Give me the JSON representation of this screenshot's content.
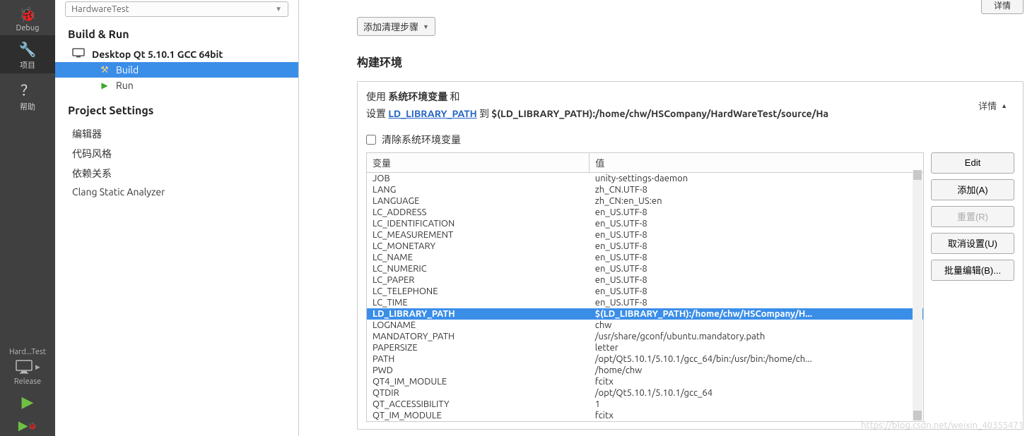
{
  "iconbar": {
    "debug": "Debug",
    "projects": "项目",
    "help": "帮助",
    "kit_name": "Hard...Test",
    "build_cfg": "Release"
  },
  "sidebar": {
    "project_combo": "HardwareTest",
    "build_run": "Build & Run",
    "kit": "Desktop Qt 5.10.1 GCC 64bit",
    "tree": {
      "build": "Build",
      "run": "Run"
    },
    "project_settings": "Project Settings",
    "settings": [
      "编辑器",
      "代码风格",
      "依赖关系",
      "Clang Static Analyzer"
    ]
  },
  "main": {
    "top_detail": "详情",
    "add_clean_step": "添加清理步骤",
    "env_title": "构建环境",
    "use_prefix": "使用",
    "use_bold": "系统环境变量",
    "use_suffix": "和",
    "set_prefix": "设置",
    "set_link": "LD_LIBRARY_PATH",
    "set_mid": "到",
    "set_val": "$(LD_LIBRARY_PATH):/home/chw/HSCompany/HardWareTest/source/Ha",
    "details": "详情",
    "clear_env": "清除系统环境变量",
    "col_var": "变量",
    "col_val": "值",
    "rows": [
      {
        "k": "JOB",
        "v": "unity-settings-daemon"
      },
      {
        "k": "LANG",
        "v": "zh_CN.UTF-8"
      },
      {
        "k": "LANGUAGE",
        "v": "zh_CN:en_US:en"
      },
      {
        "k": "LC_ADDRESS",
        "v": "en_US.UTF-8"
      },
      {
        "k": "LC_IDENTIFICATION",
        "v": "en_US.UTF-8"
      },
      {
        "k": "LC_MEASUREMENT",
        "v": "en_US.UTF-8"
      },
      {
        "k": "LC_MONETARY",
        "v": "en_US.UTF-8"
      },
      {
        "k": "LC_NAME",
        "v": "en_US.UTF-8"
      },
      {
        "k": "LC_NUMERIC",
        "v": "en_US.UTF-8"
      },
      {
        "k": "LC_PAPER",
        "v": "en_US.UTF-8"
      },
      {
        "k": "LC_TELEPHONE",
        "v": "en_US.UTF-8"
      },
      {
        "k": "LC_TIME",
        "v": "en_US.UTF-8"
      },
      {
        "k": "LD_LIBRARY_PATH",
        "v": "$(LD_LIBRARY_PATH):/home/chw/HSCompany/H...",
        "sel": true
      },
      {
        "k": "LOGNAME",
        "v": "chw"
      },
      {
        "k": "MANDATORY_PATH",
        "v": "/usr/share/gconf/ubuntu.mandatory.path"
      },
      {
        "k": "PAPERSIZE",
        "v": "letter"
      },
      {
        "k": "PATH",
        "v": "/opt/Qt5.10.1/5.10.1/gcc_64/bin:/usr/bin:/home/ch..."
      },
      {
        "k": "PWD",
        "v": "/home/chw"
      },
      {
        "k": "QT4_IM_MODULE",
        "v": "fcitx"
      },
      {
        "k": "QTDIR",
        "v": "/opt/Qt5.10.1/5.10.1/gcc_64"
      },
      {
        "k": "QT_ACCESSIBILITY",
        "v": "1"
      },
      {
        "k": "QT_IM_MODULE",
        "v": "fcitx"
      }
    ],
    "buttons": {
      "edit": "Edit",
      "add": "添加(A)",
      "reset": "重置(R)",
      "unset": "取消设置(U)",
      "batch": "批量编辑(B)..."
    }
  },
  "watermark": "https://blog.csdn.net/weixin_40355471"
}
